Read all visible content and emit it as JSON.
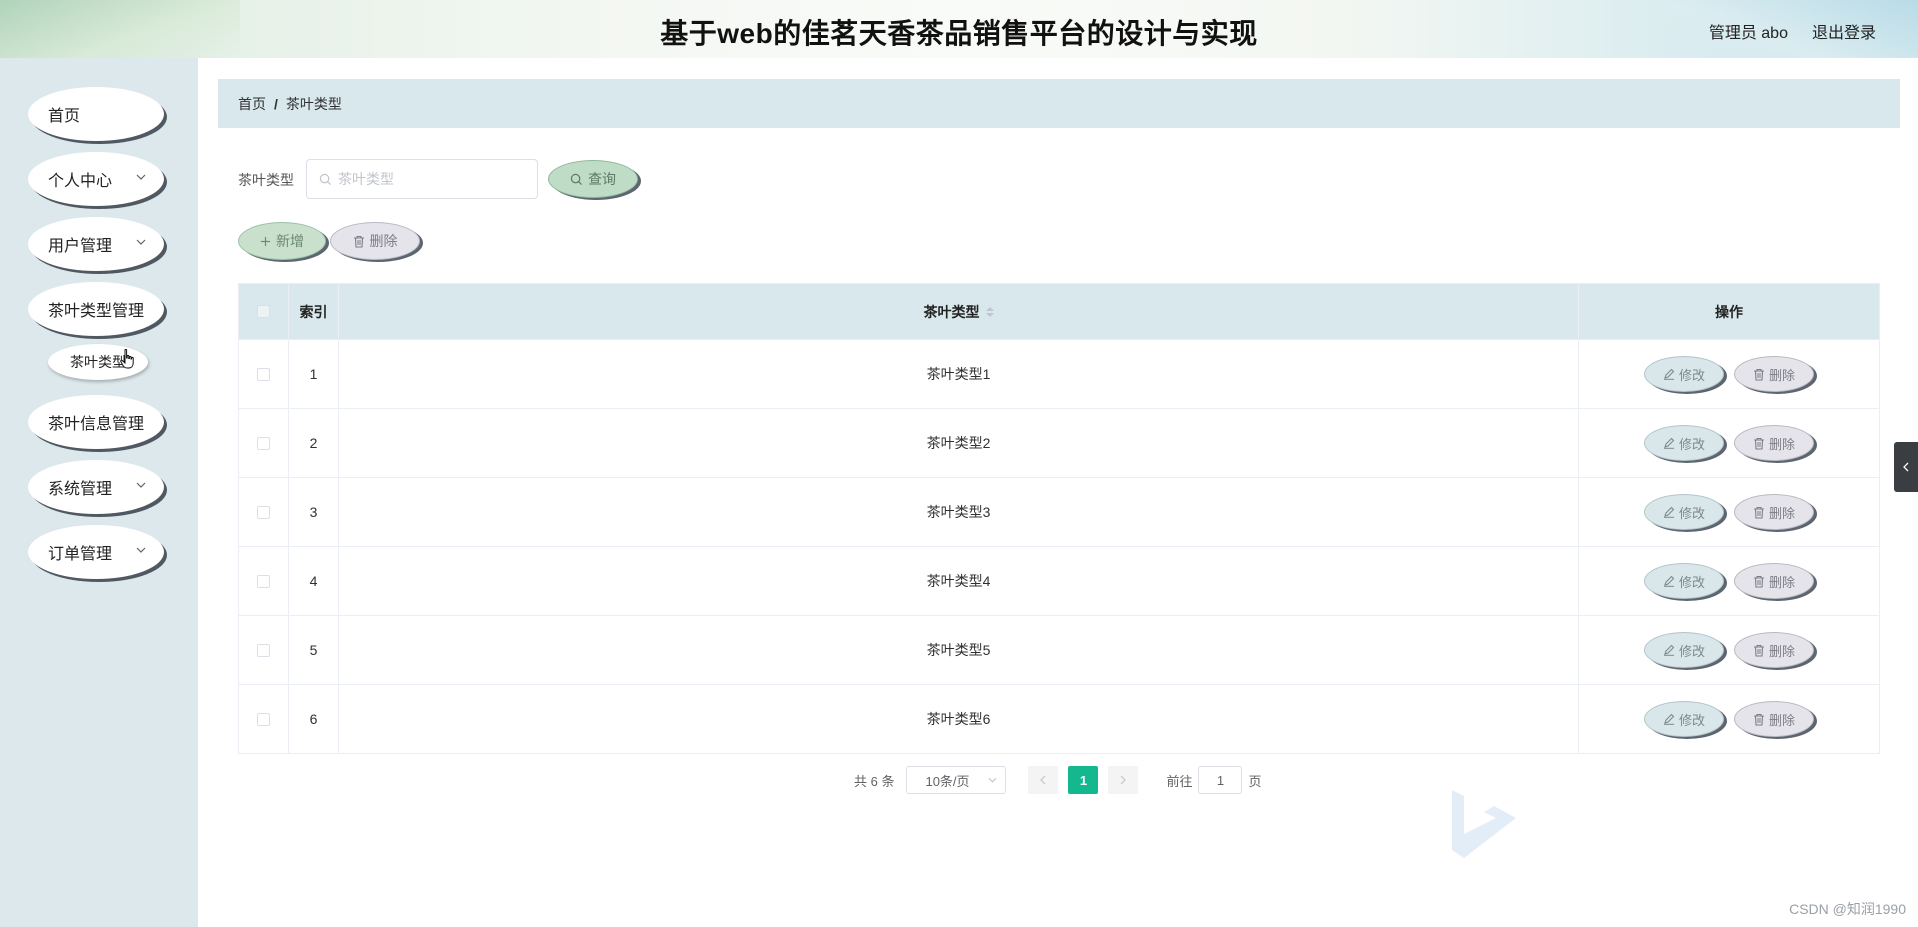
{
  "header": {
    "title": "基于web的佳茗天香茶品销售平台的设计与实现",
    "user_label": "管理员 abo",
    "logout_label": "退出登录"
  },
  "sidebar": {
    "items": [
      {
        "label": "首页",
        "has_chevron": false
      },
      {
        "label": "个人中心",
        "has_chevron": true
      },
      {
        "label": "用户管理",
        "has_chevron": true
      },
      {
        "label": "茶叶类型管理",
        "has_chevron": false
      },
      {
        "label": "茶叶信息管理",
        "has_chevron": false
      },
      {
        "label": "系统管理",
        "has_chevron": true
      },
      {
        "label": "订单管理",
        "has_chevron": true
      }
    ],
    "sub_item": {
      "label": "茶叶类型"
    }
  },
  "breadcrumb": {
    "home": "首页",
    "separator": "/",
    "current": "茶叶类型"
  },
  "search": {
    "label": "茶叶类型",
    "placeholder": "茶叶类型",
    "value": "",
    "query_label": "查询"
  },
  "actions": {
    "add_label": "新增",
    "delete_label": "删除"
  },
  "table": {
    "headers": {
      "index": "索引",
      "type": "茶叶类型",
      "ops": "操作"
    },
    "rows": [
      {
        "index": "1",
        "type": "茶叶类型1"
      },
      {
        "index": "2",
        "type": "茶叶类型2"
      },
      {
        "index": "3",
        "type": "茶叶类型3"
      },
      {
        "index": "4",
        "type": "茶叶类型4"
      },
      {
        "index": "5",
        "type": "茶叶类型5"
      },
      {
        "index": "6",
        "type": "茶叶类型6"
      }
    ],
    "edit_label": "修改",
    "delete_label": "删除"
  },
  "pagination": {
    "total": "共 6 条",
    "page_size": "10条/页",
    "current_page": "1",
    "goto_prefix": "前往",
    "goto_value": "1",
    "goto_suffix": "页"
  },
  "watermark": "CSDN @知润1990",
  "colors": {
    "accent": "#14b88f",
    "sidebar_bg": "#dce8ec",
    "header_strip": "#d9e8ec"
  }
}
